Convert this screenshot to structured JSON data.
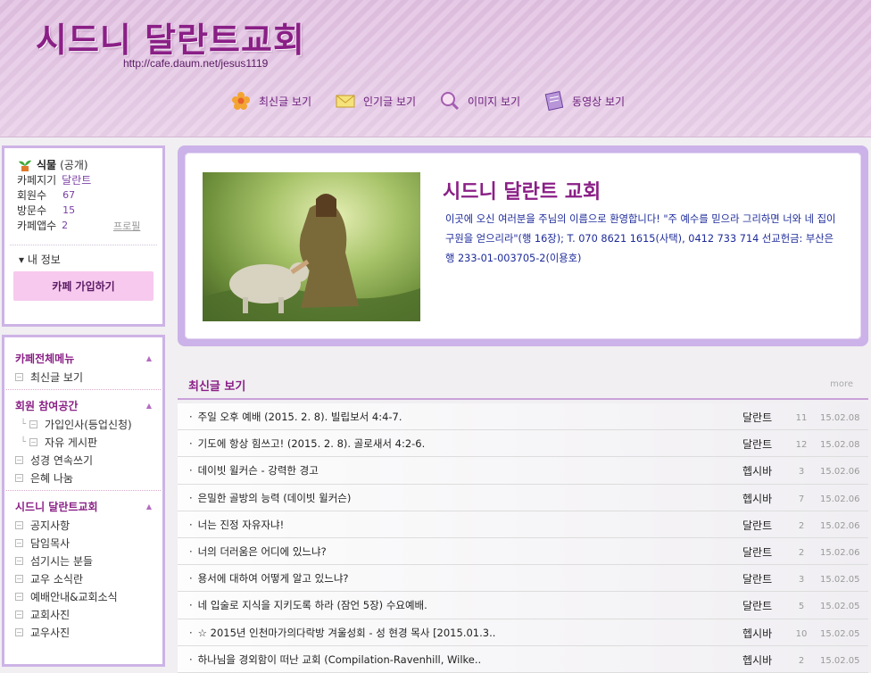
{
  "header": {
    "title": "시드니 달란트교회",
    "url": "http://cafe.daum.net/jesus1119",
    "nav": [
      {
        "label": "최신글 보기",
        "icon": "flower-icon"
      },
      {
        "label": "인기글 보기",
        "icon": "envelope-icon"
      },
      {
        "label": "이미지 보기",
        "icon": "magnifier-icon"
      },
      {
        "label": "동영상 보기",
        "icon": "notepad-icon"
      }
    ]
  },
  "profile": {
    "level_label": "식물",
    "visibility": "(공개)",
    "manager_label": "카페지기",
    "manager_value": "달란트",
    "members_label": "회원수",
    "members_value": "67",
    "visitors_label": "방문수",
    "visitors_value": "15",
    "app_label": "카페앱수",
    "app_value": "2",
    "profile_link": "프로필",
    "my_info": "▾ 내 정보",
    "join_button": "카페 가입하기"
  },
  "menu": {
    "sections": [
      {
        "title": "카페전체메뉴",
        "items": [
          {
            "label": "최신글 보기",
            "sub": false
          }
        ]
      },
      {
        "title": "회원 참여공간",
        "items": [
          {
            "label": "가입인사(등업신청)",
            "sub": true
          },
          {
            "label": "자유 게시판",
            "sub": true
          },
          {
            "label": "성경 연속쓰기",
            "sub": false
          },
          {
            "label": "은혜 나눔",
            "sub": false
          }
        ]
      },
      {
        "title": "시드니 달란트교회",
        "items": [
          {
            "label": "공지사항",
            "sub": false
          },
          {
            "label": "담임목사",
            "sub": false
          },
          {
            "label": "섬기시는 분들",
            "sub": false
          },
          {
            "label": "교우 소식란",
            "sub": false
          },
          {
            "label": "예배안내&교회소식",
            "sub": false
          },
          {
            "label": "교회사진",
            "sub": false
          },
          {
            "label": "교우사진",
            "sub": false
          }
        ]
      }
    ]
  },
  "welcome": {
    "title": "시드니 달란트 교회",
    "text": "이곳에 오신 여러분을 주님의 이름으로 환영합니다! \"주 예수를 믿으라 그리하면 너와 네 집이 구원을 얻으리라\"(행 16장); T. 070 8621 1615(사택), 0412 733 714 선교헌금: 부산은행 233-01-003705-2(이용호)"
  },
  "latest": {
    "title": "최신글 보기",
    "more": "more",
    "rows": [
      {
        "title": "주일 오후 예배 (2015. 2. 8). 빌립보서 4:4-7.",
        "author": "달란트",
        "count": "11",
        "date": "15.02.08"
      },
      {
        "title": "기도에 항상 힘쓰고! (2015. 2. 8). 골로새서 4:2-6.",
        "author": "달란트",
        "count": "12",
        "date": "15.02.08"
      },
      {
        "title": "데이빗 윌커슨 - 강력한 경고",
        "author": "헵시바",
        "count": "3",
        "date": "15.02.06"
      },
      {
        "title": "은밀한 골방의 능력 (데이빗 윌커슨)",
        "author": "헵시바",
        "count": "7",
        "date": "15.02.06"
      },
      {
        "title": "너는 진정 자유자냐!",
        "author": "달란트",
        "count": "2",
        "date": "15.02.06"
      },
      {
        "title": "너의 더러움은 어디에 있느냐?",
        "author": "달란트",
        "count": "2",
        "date": "15.02.06"
      },
      {
        "title": "용서에 대하여 어떻게 알고 있느냐?",
        "author": "달란트",
        "count": "3",
        "date": "15.02.05"
      },
      {
        "title": "네 입술로 지식을 지키도록 하라 (잠언 5장) 수요예배.",
        "author": "달란트",
        "count": "5",
        "date": "15.02.05"
      },
      {
        "title": "☆ 2015년 인천마가의다락방 겨울성회 - 성 현경 목사 [2015.01.3..",
        "author": "헵시바",
        "count": "10",
        "date": "15.02.05"
      },
      {
        "title": "하나님을 경외함이 떠난 교회 (Compilation-Ravenhill, Wilke..",
        "author": "헵시바",
        "count": "2",
        "date": "15.02.05"
      }
    ]
  },
  "colors": {
    "accent": "#8a1f86",
    "border": "#cdb3e6",
    "link": "#1c2a9a"
  }
}
